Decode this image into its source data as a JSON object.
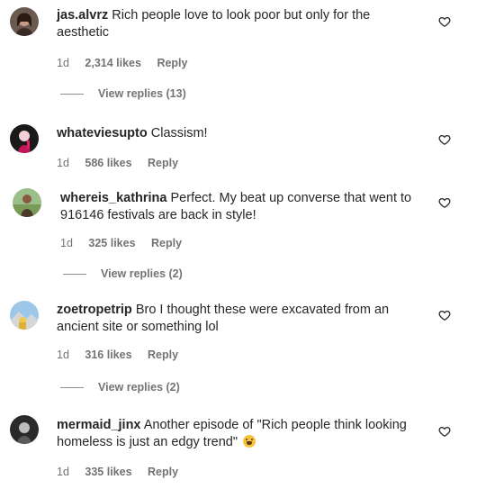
{
  "comments": [
    {
      "username": "jas.alvrz",
      "text": "Rich people love to look poor but only for the aesthetic",
      "time": "1d",
      "likes": "2,314 likes",
      "reply_label": "Reply",
      "view_replies": "View replies (13)",
      "avatar_icon": "avatar-woman-dark-hair"
    },
    {
      "username": "whateviesupto",
      "text": "Classism!",
      "time": "1d",
      "likes": "586 likes",
      "reply_label": "Reply",
      "avatar_icon": "avatar-red-pink"
    },
    {
      "username": "whereis_kathrina",
      "text": "Perfect. My beat up converse that went to 916146 festivals are back in style!",
      "time": "1d",
      "likes": "325 likes",
      "reply_label": "Reply",
      "view_replies": "View replies (2)",
      "avatar_icon": "avatar-outdoor-woman"
    },
    {
      "username": "zoetropetrip",
      "text": "Bro I thought these were excavated from an ancient site or something lol",
      "time": "1d",
      "likes": "316 likes",
      "reply_label": "Reply",
      "view_replies": "View replies (2)",
      "avatar_icon": "avatar-mountain-scene"
    },
    {
      "username": "mermaid_jinx",
      "text": "Another episode of \"Rich people think looking homeless is just an edgy trend\"",
      "emoji": "weary-face-emoji",
      "time": "1d",
      "likes": "335 likes",
      "reply_label": "Reply",
      "avatar_icon": "avatar-dark-figure"
    }
  ],
  "icons": {
    "like": "heart-outline-icon"
  },
  "colors": {
    "text": "#262626",
    "meta": "#737373",
    "background": "#ffffff"
  }
}
